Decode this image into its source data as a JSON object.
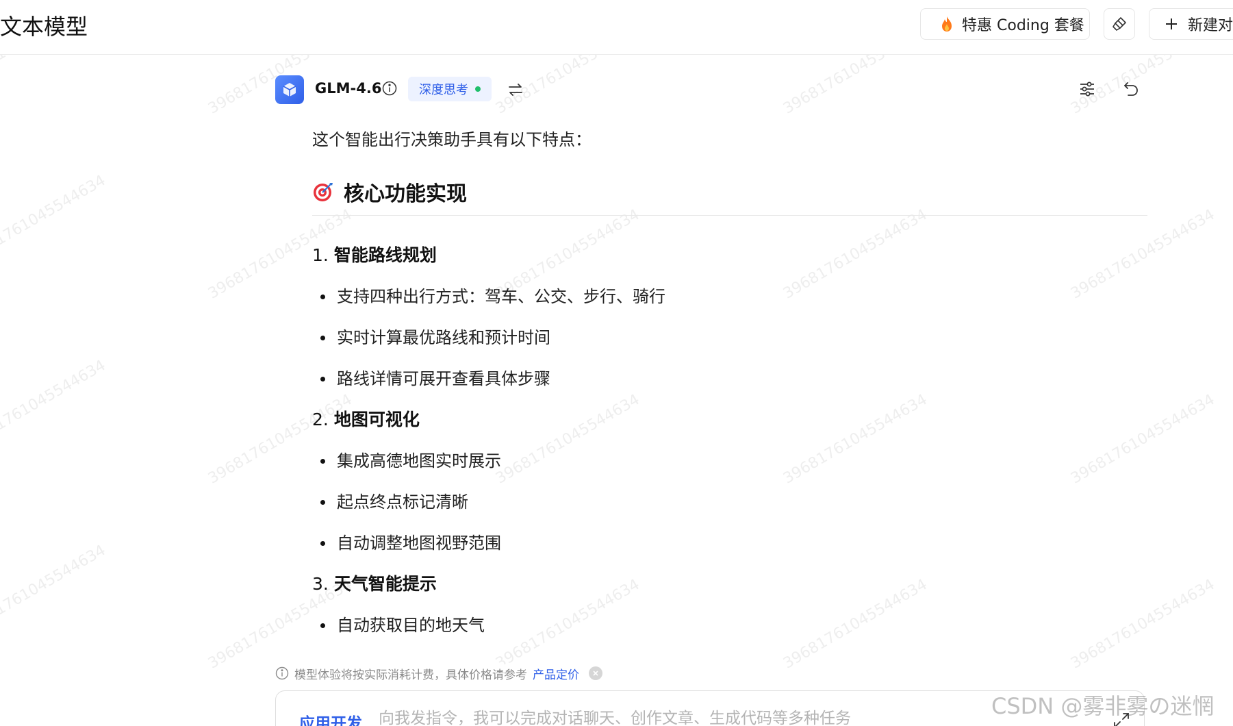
{
  "header": {
    "title": "文本模型",
    "promo_label": "特惠 Coding 套餐",
    "new_chat_label": "新建对"
  },
  "model": {
    "name": "GLM-4.6",
    "deep_think_label": "深度思考"
  },
  "content": {
    "intro": "这个智能出行决策助手具有以下特点：",
    "heading": "核心功能实现",
    "sections": [
      {
        "title_num": "1. ",
        "title": "智能路线规划",
        "items": [
          "支持四种出行方式：驾车、公交、步行、骑行",
          "实时计算最优路线和预计时间",
          "路线详情可展开查看具体步骤"
        ]
      },
      {
        "title_num": "2. ",
        "title": "地图可视化",
        "items": [
          "集成高德地图实时展示",
          "起点终点标记清晰",
          "自动调整地图视野范围"
        ]
      },
      {
        "title_num": "3. ",
        "title": "天气智能提示",
        "items": [
          "自动获取目的地天气"
        ]
      }
    ]
  },
  "notice": {
    "text": "模型体验将按实际消耗计费，具体价格请参考",
    "link": "产品定价"
  },
  "input": {
    "mode_label": "应用开发",
    "placeholder": "向我发指令，我可以完成对话聊天、创作文章、生成代码等多种任务"
  },
  "watermark": {
    "text": "39681761045544634",
    "csdn": "CSDN @雾非雾の迷惘"
  },
  "colors": {
    "accent": "#2f5fe8",
    "status_dot": "#1fbf6b"
  }
}
